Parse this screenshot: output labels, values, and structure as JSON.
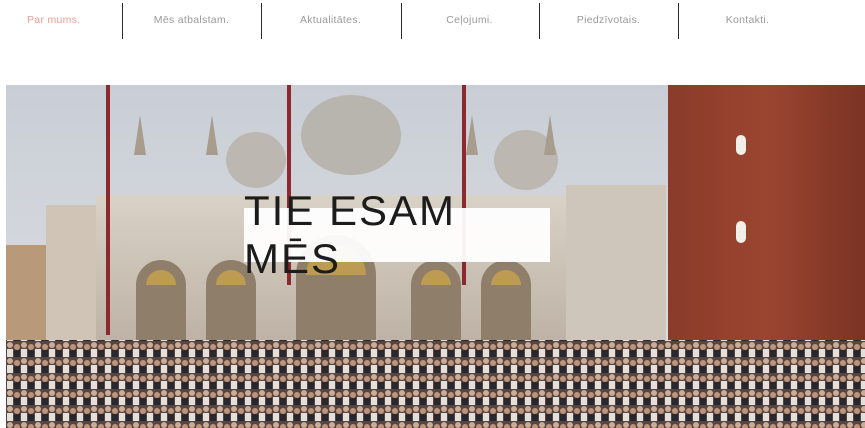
{
  "nav": {
    "items": [
      {
        "label": "Par mums.",
        "active": true
      },
      {
        "label": "Mēs atbalstam.",
        "active": false
      },
      {
        "label": "Aktualitātes.",
        "active": false
      },
      {
        "label": "Ceļojumi.",
        "active": false
      },
      {
        "label": "Piedzīvotais.",
        "active": false
      },
      {
        "label": "Kontakti.",
        "active": false
      }
    ]
  },
  "hero": {
    "title": "TIE ESAM MĒS"
  },
  "colors": {
    "active_nav": "#e8a092",
    "nav_text": "#9a9a9a",
    "separator": "#2a2a2a"
  }
}
